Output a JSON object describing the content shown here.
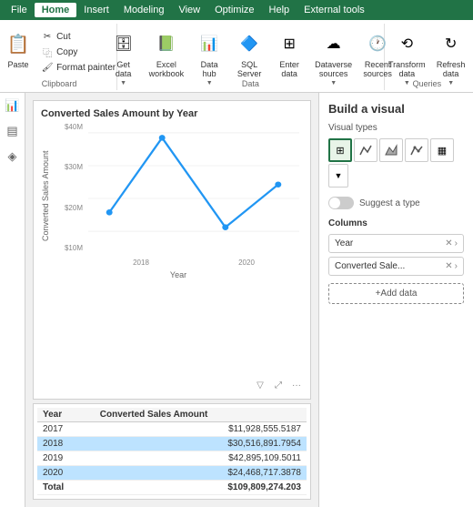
{
  "menubar": {
    "items": [
      "File",
      "Home",
      "Insert",
      "Modeling",
      "View",
      "Optimize",
      "Help",
      "External tools"
    ],
    "active": "Home"
  },
  "ribbon": {
    "groups": [
      {
        "label": "Clipboard",
        "buttons": [
          {
            "id": "paste",
            "icon": "📋",
            "label": "Paste"
          }
        ],
        "small_buttons": [
          {
            "id": "cut",
            "icon": "✂",
            "label": "Cut"
          },
          {
            "id": "copy",
            "icon": "⿻",
            "label": "Copy"
          },
          {
            "id": "format-painter",
            "icon": "🖌",
            "label": "Format painter"
          }
        ]
      },
      {
        "label": "Data",
        "buttons": [
          {
            "id": "get-data",
            "label": "Get\ndata",
            "icon": "🗄"
          },
          {
            "id": "excel-workbook",
            "label": "Excel\nworkbook",
            "icon": "📗"
          },
          {
            "id": "data-hub",
            "label": "Data\nhub",
            "icon": "📊"
          },
          {
            "id": "sql-server",
            "label": "SQL\nServer",
            "icon": "🔷"
          },
          {
            "id": "enter-data",
            "label": "Enter\ndata",
            "icon": "⊞"
          },
          {
            "id": "dataverse",
            "label": "Dataverse\nsources",
            "icon": "☁"
          },
          {
            "id": "recent-sources",
            "label": "Recent\nsources",
            "icon": "🕐"
          }
        ]
      },
      {
        "label": "Queries",
        "buttons": [
          {
            "id": "transform-data",
            "label": "Transform\ndata",
            "icon": "⟲"
          },
          {
            "id": "refresh-data",
            "label": "Refresh\ndata",
            "icon": "↻"
          }
        ]
      }
    ]
  },
  "chart": {
    "title": "Converted Sales Amount by Year",
    "y_label": "Converted Sales Amount",
    "x_label": "Year",
    "y_ticks": [
      "$40M",
      "$30M",
      "$20M",
      "$10M"
    ],
    "x_ticks": [
      "2018",
      "2020"
    ],
    "line_color": "#2196F3",
    "points": [
      {
        "x": 0.15,
        "y": 0.72
      },
      {
        "x": 0.38,
        "y": 0.1
      },
      {
        "x": 0.65,
        "y": 0.85
      },
      {
        "x": 0.85,
        "y": 0.55
      }
    ]
  },
  "table": {
    "headers": [
      "Year",
      "Converted Sales Amount"
    ],
    "rows": [
      {
        "year": "2017",
        "amount": "$11,928,555.5187",
        "highlighted": false
      },
      {
        "year": "2018",
        "amount": "$30,516,891.7954",
        "highlighted": true
      },
      {
        "year": "2019",
        "amount": "$42,895,109.5011",
        "highlighted": false
      },
      {
        "year": "2020",
        "amount": "$24,468,717.3878",
        "highlighted": true
      }
    ],
    "total_label": "Total",
    "total_amount": "$109,809,274.203"
  },
  "right_panel": {
    "title": "Build a visual",
    "visual_types_label": "Visual types",
    "visual_types": [
      {
        "id": "table",
        "icon": "⊞",
        "active": true
      },
      {
        "id": "line",
        "icon": "╱"
      },
      {
        "id": "area",
        "icon": "△"
      },
      {
        "id": "line2",
        "icon": "📈"
      },
      {
        "id": "matrix",
        "icon": "▦"
      }
    ],
    "suggest_label": "Suggest a type",
    "columns_label": "Columns",
    "columns": [
      {
        "id": "year",
        "label": "Year"
      },
      {
        "id": "converted-sales",
        "label": "Converted Sale..."
      }
    ],
    "add_data_label": "+Add data"
  },
  "sidebar_icons": [
    "📊",
    "📋",
    "🔧"
  ]
}
